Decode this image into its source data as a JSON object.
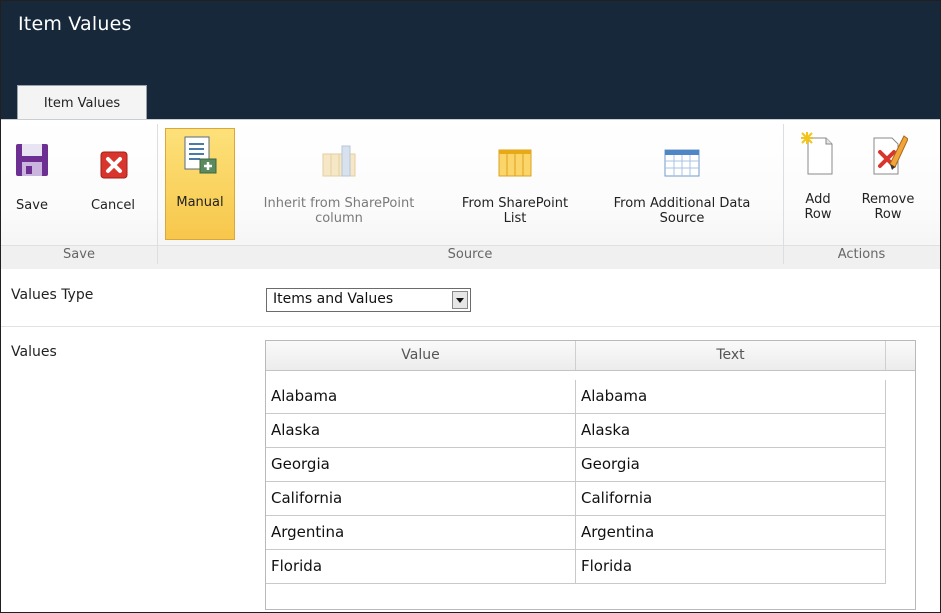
{
  "window": {
    "title": "Item Values"
  },
  "tabs": [
    {
      "label": "Item Values"
    }
  ],
  "ribbon": {
    "groups": {
      "save": {
        "label": "Save",
        "buttons": {
          "save": "Save",
          "cancel": "Cancel"
        }
      },
      "source": {
        "label": "Source",
        "buttons": {
          "manual": "Manual",
          "inherit_line1": "Inherit from SharePoint",
          "inherit_line2": "column",
          "from_list_line1": "From SharePoint",
          "from_list_line2": "List",
          "from_additional_line1": "From Additional Data",
          "from_additional_line2": "Source"
        }
      },
      "actions": {
        "label": "Actions",
        "buttons": {
          "add_line1": "Add",
          "add_line2": "Row",
          "remove_line1": "Remove",
          "remove_line2": "Row"
        }
      }
    }
  },
  "form": {
    "values_type": {
      "label": "Values Type",
      "selected": "Items and Values"
    },
    "values": {
      "label": "Values",
      "columns": [
        "Value",
        "Text"
      ],
      "rows": [
        [
          "Alabama",
          "Alabama"
        ],
        [
          "Alaska",
          "Alaska"
        ],
        [
          "Georgia",
          "Georgia"
        ],
        [
          "California",
          "California"
        ],
        [
          "Argentina",
          "Argentina"
        ],
        [
          "Florida",
          "Florida"
        ]
      ]
    }
  },
  "colors": {
    "title_bar": "#17283b",
    "selected_button": "#f7c74b"
  }
}
